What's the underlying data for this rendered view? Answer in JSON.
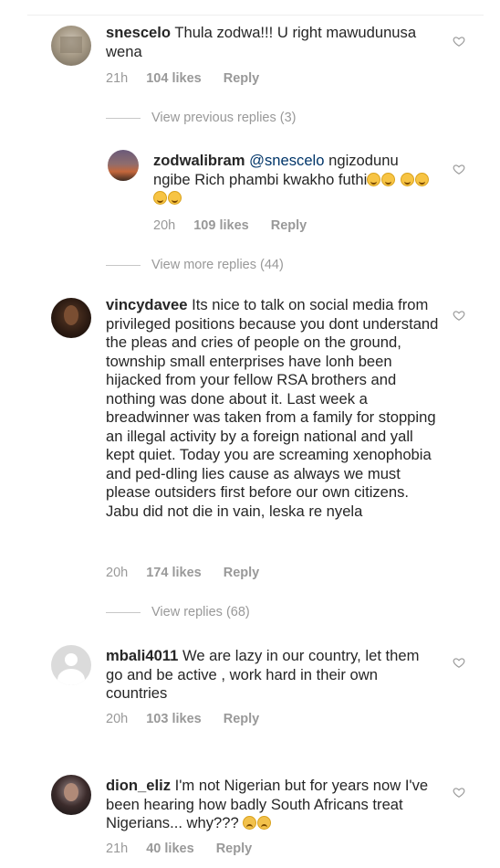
{
  "comments": [
    {
      "username": "snescelo",
      "text": "Thula zodwa!!! U right mawudunusa wena",
      "time": "21h",
      "likes": "104 likes",
      "reply": "Reply",
      "view_replies": "View previous replies (3)"
    },
    {
      "username": "zodwalibram",
      "mention": "@snescelo",
      "text": "ngizodunu ngibe Rich phambi kwakho futhi",
      "time": "20h",
      "likes": "109 likes",
      "reply": "Reply",
      "view_replies": "View more replies (44)"
    },
    {
      "username": "vincydavee",
      "text": "Its nice to talk on social media from privileged positions because you dont understand the pleas and cries of people on the ground, township small enterprises have lonh been hijacked from your fellow RSA brothers and nothing was done about it. Last week a breadwinner was taken from a family for stopping an illegal activity by a foreign national and yall kept quiet. Today you are screaming xenophobia and ped-dling lies cause as always we must please outsiders first before our own citizens. Jabu did not die in vain, leska re nyela",
      "time": "20h",
      "likes": "174 likes",
      "reply": "Reply",
      "view_replies": "View replies (68)"
    },
    {
      "username": "mbali4011",
      "text": "We are lazy in our country, let them go and be active , work hard in their own countries",
      "time": "20h",
      "likes": "103 likes",
      "reply": "Reply"
    },
    {
      "username": "dion_eliz",
      "text": "I'm not Nigerian but for years now I've been hearing how badly South Africans treat Nigerians... why???",
      "time": "21h",
      "likes": "40 likes",
      "reply": "Reply"
    }
  ],
  "icons": {
    "like": "heart-outline-icon",
    "emoji_laugh": "laughing-emoji",
    "emoji_sad": "crying-emoji"
  },
  "colors": {
    "text": "#262626",
    "muted": "#999999",
    "link": "#003569"
  }
}
